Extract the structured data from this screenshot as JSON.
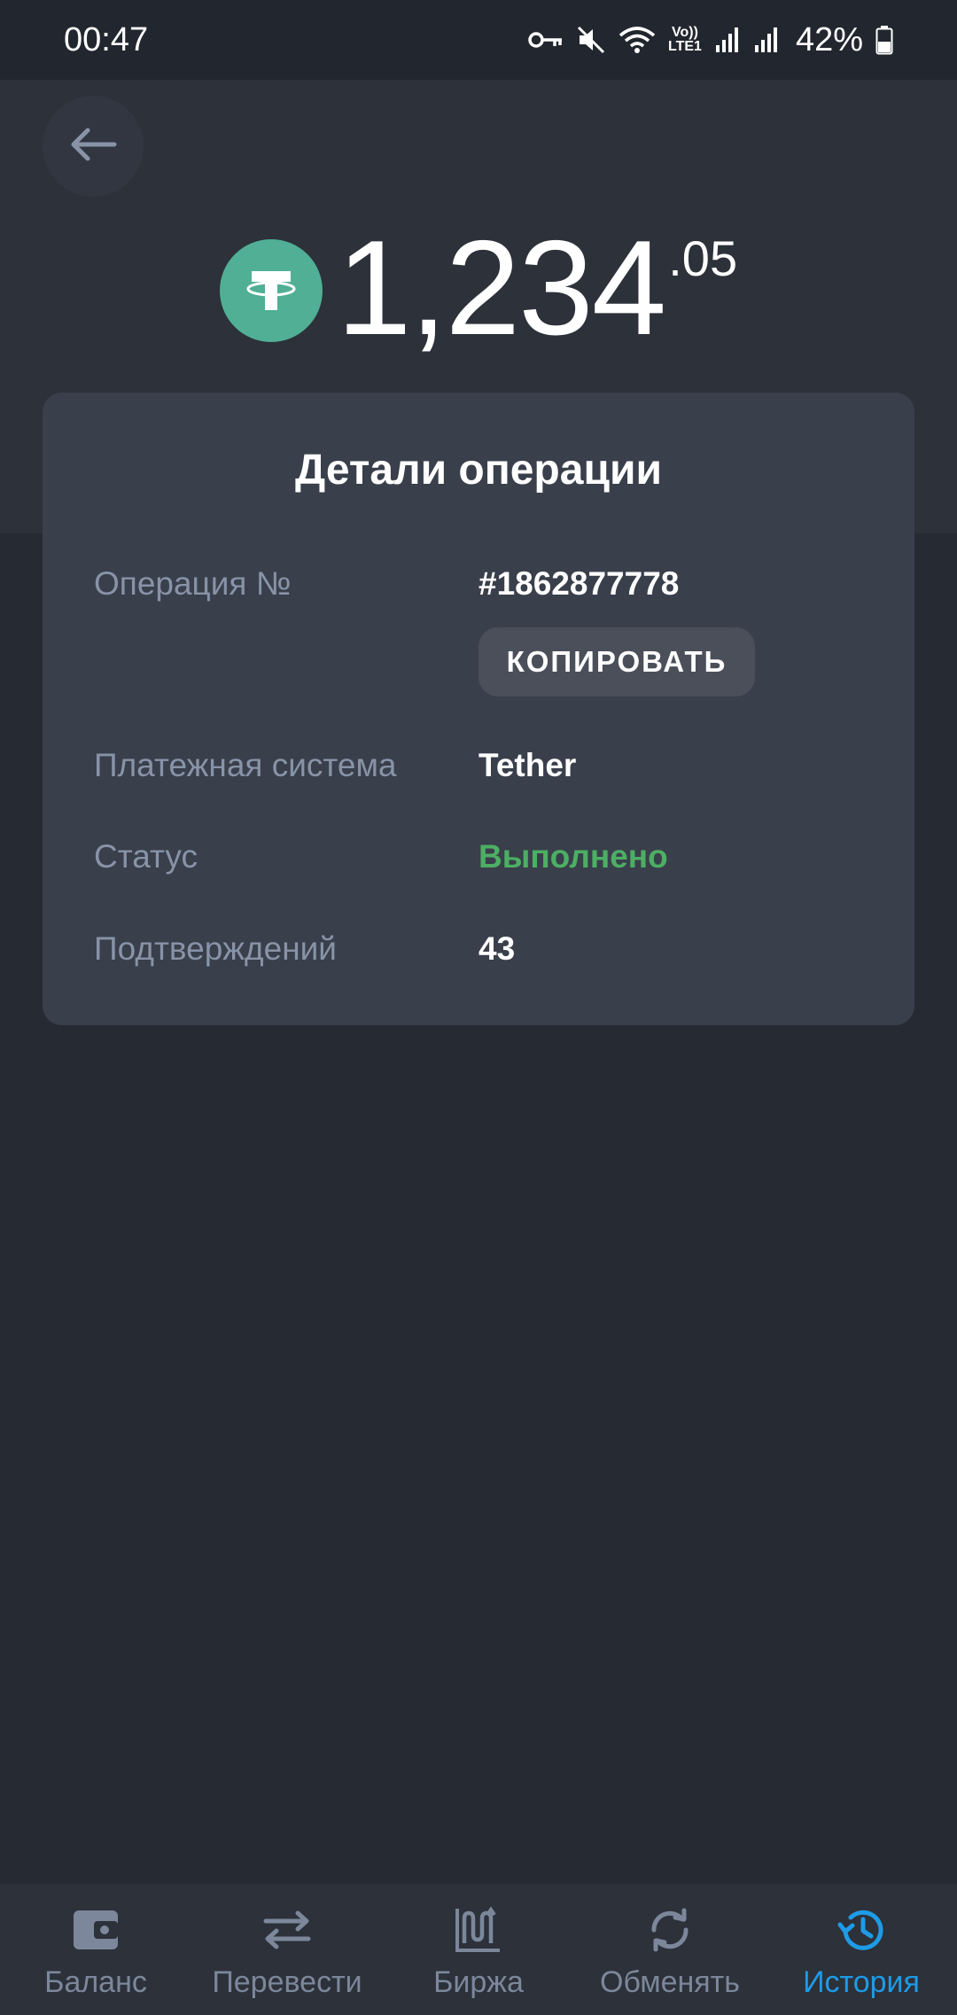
{
  "status_bar": {
    "time": "00:47",
    "network_label": "LTE1",
    "volte_label": "Vo))",
    "battery": "42%"
  },
  "header": {
    "amount_integer": "1,234",
    "amount_decimal": ".05",
    "currency_icon": "tether-icon",
    "currency_color": "#50af95"
  },
  "details": {
    "title": "Детали операции",
    "rows": [
      {
        "label": "Операция №",
        "value": "#1862877778"
      },
      {
        "label": "Платежная система",
        "value": "Tether"
      },
      {
        "label": "Статус",
        "value": "Выполнено"
      },
      {
        "label": "Подтверждений",
        "value": "43"
      }
    ],
    "copy_label": "КОПИРОВАТЬ",
    "status_color": "#4caf63"
  },
  "nav": {
    "items": [
      {
        "label": "Баланс",
        "icon": "wallet-icon"
      },
      {
        "label": "Перевести",
        "icon": "transfer-arrows-icon"
      },
      {
        "label": "Биржа",
        "icon": "exchange-chart-icon"
      },
      {
        "label": "Обменять",
        "icon": "swap-refresh-icon"
      },
      {
        "label": "История",
        "icon": "history-clock-icon"
      }
    ],
    "active_index": 4,
    "active_color": "#1e9be6",
    "inactive_color": "#7c879b"
  }
}
